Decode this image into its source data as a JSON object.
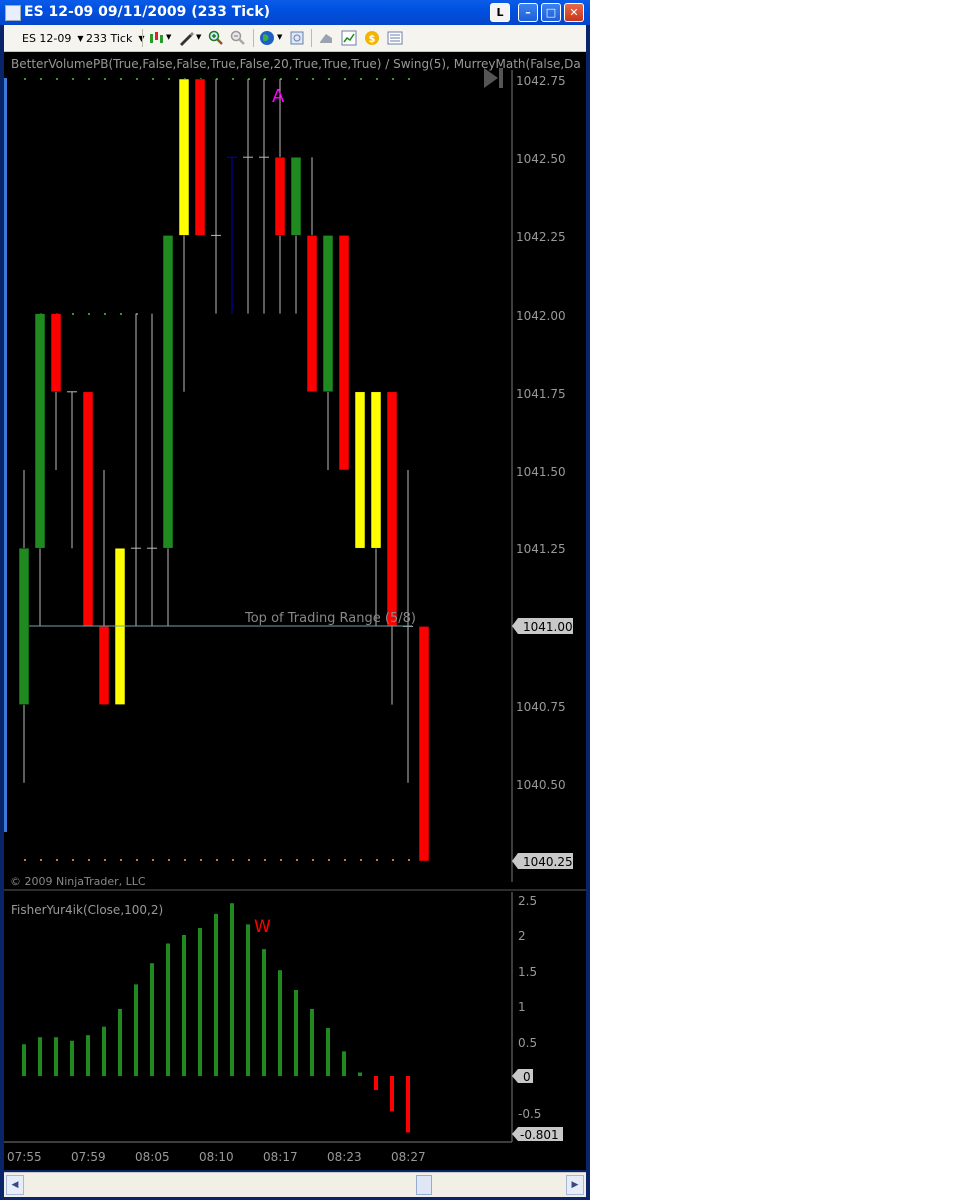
{
  "window": {
    "title": "ES 12-09  09/11/2009 (233 Tick)",
    "buttons": {
      "link": "L",
      "minimize": "–",
      "maximize": "□",
      "close": "✕"
    }
  },
  "toolbar": {
    "instrument": "ES 12-09",
    "interval": "233 Tick",
    "icons": [
      "bar-style-icon",
      "draw-tool-icon",
      "zoom-in-icon",
      "zoom-out-icon",
      "globe-icon",
      "properties-icon",
      "chart-trader-icon",
      "strategy-icon",
      "currency-icon",
      "data-box-icon"
    ]
  },
  "price_panel": {
    "indicator_label": "BetterVolumePB(True,False,False,True,False,20,True,True,True)  /  Swing(5),  MurreyMath(False,Da",
    "y_ticks": [
      "1042.75",
      "1042.50",
      "1042.25",
      "1042.00",
      "1041.75",
      "1041.50",
      "1041.25",
      "1040.75",
      "1040.50"
    ],
    "price_markers": [
      "1041.00",
      "1040.25"
    ],
    "annotation_a": "A",
    "range_label": "Top of Trading Range (5/8)",
    "copyright": "© 2009 NinjaTrader, LLC",
    "colors": {
      "up": "#1f8a1f",
      "down": "#ff0000",
      "volume_climax": "#ffff00",
      "doji": "#0000c0",
      "wick": "#bbbbbb",
      "grid": "#7a7a7a",
      "axis_text": "#999999",
      "annotation_a": "#ff00ff"
    }
  },
  "fisher_panel": {
    "label": "FisherYur4ik(Close,100,2)",
    "y_ticks": [
      "2.5",
      "2",
      "1.5",
      "1",
      "0.5",
      "-0.5"
    ],
    "markers": [
      "0",
      "-0.801"
    ],
    "annotation_w": "W",
    "colors": {
      "positive": "#1f8a1f",
      "negative": "#ff0000",
      "annotation_w": "#ff0000"
    }
  },
  "time_axis": [
    "07:55",
    "07:59",
    "08:05",
    "08:10",
    "08:17",
    "08:23",
    "08:27"
  ],
  "chart_data": [
    {
      "type": "candlestick",
      "instrument": "ES 12-09",
      "ylim": [
        1040.25,
        1042.75
      ],
      "bars": [
        {
          "o": 1040.75,
          "h": 1041.5,
          "l": 1040.5,
          "c": 1041.25,
          "color": "green"
        },
        {
          "o": 1041.25,
          "h": 1042.0,
          "l": 1041.0,
          "c": 1042.0,
          "color": "green"
        },
        {
          "o": 1042.0,
          "h": 1042.0,
          "l": 1041.5,
          "c": 1041.75,
          "color": "red"
        },
        {
          "o": 1041.75,
          "h": 1041.75,
          "l": 1041.25,
          "c": 1041.75,
          "color": "doji"
        },
        {
          "o": 1041.75,
          "h": 1041.75,
          "l": 1041.0,
          "c": 1041.0,
          "color": "red"
        },
        {
          "o": 1041.0,
          "h": 1041.5,
          "l": 1040.75,
          "c": 1040.75,
          "color": "red"
        },
        {
          "o": 1040.75,
          "h": 1041.25,
          "l": 1040.75,
          "c": 1041.25,
          "color": "yellow"
        },
        {
          "o": 1041.25,
          "h": 1042.0,
          "l": 1041.0,
          "c": 1041.25,
          "color": "doji"
        },
        {
          "o": 1041.25,
          "h": 1042.0,
          "l": 1041.0,
          "c": 1041.25,
          "color": "doji"
        },
        {
          "o": 1041.25,
          "h": 1042.25,
          "l": 1041.0,
          "c": 1042.25,
          "color": "green"
        },
        {
          "o": 1042.25,
          "h": 1042.75,
          "l": 1041.75,
          "c": 1042.75,
          "color": "yellow"
        },
        {
          "o": 1042.75,
          "h": 1042.75,
          "l": 1042.25,
          "c": 1042.25,
          "color": "red"
        },
        {
          "o": 1042.25,
          "h": 1042.75,
          "l": 1042.0,
          "c": 1042.25,
          "color": "doji"
        },
        {
          "o": 1042.5,
          "h": 1042.5,
          "l": 1042.0,
          "c": 1042.5,
          "color": "blue-doji"
        },
        {
          "o": 1042.5,
          "h": 1042.75,
          "l": 1042.0,
          "c": 1042.5,
          "color": "doji"
        },
        {
          "o": 1042.5,
          "h": 1042.75,
          "l": 1042.0,
          "c": 1042.5,
          "color": "doji"
        },
        {
          "o": 1042.5,
          "h": 1042.75,
          "l": 1042.0,
          "c": 1042.25,
          "color": "red"
        },
        {
          "o": 1042.25,
          "h": 1042.5,
          "l": 1042.0,
          "c": 1042.5,
          "color": "green"
        },
        {
          "o": 1042.25,
          "h": 1042.5,
          "l": 1041.75,
          "c": 1041.75,
          "color": "red"
        },
        {
          "o": 1041.75,
          "h": 1042.25,
          "l": 1041.5,
          "c": 1042.25,
          "color": "green"
        },
        {
          "o": 1042.25,
          "h": 1042.25,
          "l": 1041.5,
          "c": 1041.5,
          "color": "red"
        },
        {
          "o": 1041.75,
          "h": 1041.75,
          "l": 1041.25,
          "c": 1041.25,
          "color": "yellow"
        },
        {
          "o": 1041.75,
          "h": 1041.75,
          "l": 1041.0,
          "c": 1041.25,
          "color": "yellow"
        },
        {
          "o": 1041.75,
          "h": 1041.75,
          "l": 1040.75,
          "c": 1041.0,
          "color": "red"
        },
        {
          "o": 1041.0,
          "h": 1041.5,
          "l": 1040.5,
          "c": 1041.0,
          "color": "doji"
        },
        {
          "o": 1041.0,
          "h": 1041.0,
          "l": 1040.25,
          "c": 1040.25,
          "color": "red"
        }
      ]
    },
    {
      "type": "bar",
      "title": "FisherYur4ik(Close,100,2)",
      "ylim": [
        -0.801,
        2.5
      ],
      "values": [
        0.45,
        0.55,
        0.55,
        0.5,
        0.58,
        0.7,
        0.95,
        1.3,
        1.6,
        1.88,
        2.0,
        2.1,
        2.3,
        2.45,
        2.15,
        1.8,
        1.5,
        1.22,
        0.95,
        0.68,
        0.35,
        0.05,
        -0.2,
        -0.5,
        -0.801
      ]
    }
  ]
}
